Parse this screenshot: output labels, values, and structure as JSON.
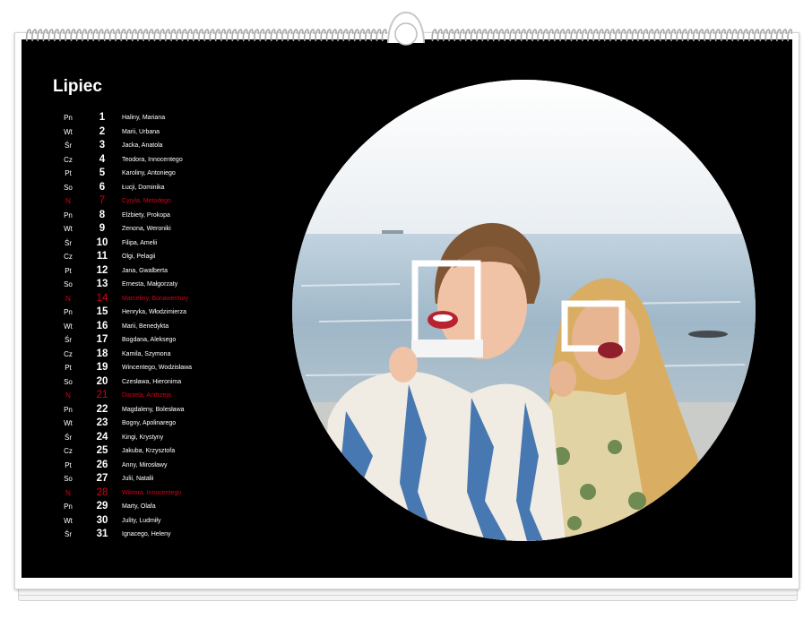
{
  "calendar": {
    "month": "Lipiec",
    "days": [
      {
        "weekday": "Pn",
        "day": "1",
        "names": "Haliny, Mariana",
        "sunday": false
      },
      {
        "weekday": "Wt",
        "day": "2",
        "names": "Marii, Urbana",
        "sunday": false
      },
      {
        "weekday": "Śr",
        "day": "3",
        "names": "Jacka, Anatola",
        "sunday": false
      },
      {
        "weekday": "Cz",
        "day": "4",
        "names": "Teodora, Innocentego",
        "sunday": false
      },
      {
        "weekday": "Pt",
        "day": "5",
        "names": "Karoliny, Antoniego",
        "sunday": false
      },
      {
        "weekday": "So",
        "day": "6",
        "names": "Łucji, Dominika",
        "sunday": false
      },
      {
        "weekday": "N",
        "day": "7",
        "names": "Cyryla, Metodego",
        "sunday": true
      },
      {
        "weekday": "Pn",
        "day": "8",
        "names": "Elżbiety, Prokopa",
        "sunday": false
      },
      {
        "weekday": "Wt",
        "day": "9",
        "names": "Zenona, Weroniki",
        "sunday": false
      },
      {
        "weekday": "Śr",
        "day": "10",
        "names": "Filipa, Amelii",
        "sunday": false
      },
      {
        "weekday": "Cz",
        "day": "11",
        "names": "Olgi, Pelagii",
        "sunday": false
      },
      {
        "weekday": "Pt",
        "day": "12",
        "names": "Jana, Gwalberta",
        "sunday": false
      },
      {
        "weekday": "So",
        "day": "13",
        "names": "Ernesta, Małgorzaty",
        "sunday": false
      },
      {
        "weekday": "N",
        "day": "14",
        "names": "Marceliny, Bonawentury",
        "sunday": true
      },
      {
        "weekday": "Pn",
        "day": "15",
        "names": "Henryka, Włodzimierza",
        "sunday": false
      },
      {
        "weekday": "Wt",
        "day": "16",
        "names": "Marii, Benedykta",
        "sunday": false
      },
      {
        "weekday": "Śr",
        "day": "17",
        "names": "Bogdana, Aleksego",
        "sunday": false
      },
      {
        "weekday": "Cz",
        "day": "18",
        "names": "Kamila, Szymona",
        "sunday": false
      },
      {
        "weekday": "Pt",
        "day": "19",
        "names": "Wincentego, Wodzisława",
        "sunday": false
      },
      {
        "weekday": "So",
        "day": "20",
        "names": "Czesława, Hieronima",
        "sunday": false
      },
      {
        "weekday": "N",
        "day": "21",
        "names": "Daniela, Andrzeja",
        "sunday": true
      },
      {
        "weekday": "Pn",
        "day": "22",
        "names": "Magdaleny, Bolesława",
        "sunday": false
      },
      {
        "weekday": "Wt",
        "day": "23",
        "names": "Bogny, Apolinarego",
        "sunday": false
      },
      {
        "weekday": "Śr",
        "day": "24",
        "names": "Kingi, Krystyny",
        "sunday": false
      },
      {
        "weekday": "Cz",
        "day": "25",
        "names": "Jakuba, Krzysztofa",
        "sunday": false
      },
      {
        "weekday": "Pt",
        "day": "26",
        "names": "Anny, Mirosławy",
        "sunday": false
      },
      {
        "weekday": "So",
        "day": "27",
        "names": "Julii, Natalii",
        "sunday": false
      },
      {
        "weekday": "N",
        "day": "28",
        "names": "Wiktora, Innocentego",
        "sunday": true
      },
      {
        "weekday": "Pn",
        "day": "29",
        "names": "Marty, Olafa",
        "sunday": false
      },
      {
        "weekday": "Wt",
        "day": "30",
        "names": "Julity, Ludmiły",
        "sunday": false
      },
      {
        "weekday": "Śr",
        "day": "31",
        "names": "Ignacego, Heleny",
        "sunday": false
      }
    ]
  },
  "colors": {
    "background": "#000000",
    "text": "#ffffff",
    "sunday": "#d0021b"
  },
  "photo": {
    "icon": "photo-two-women-beach"
  }
}
